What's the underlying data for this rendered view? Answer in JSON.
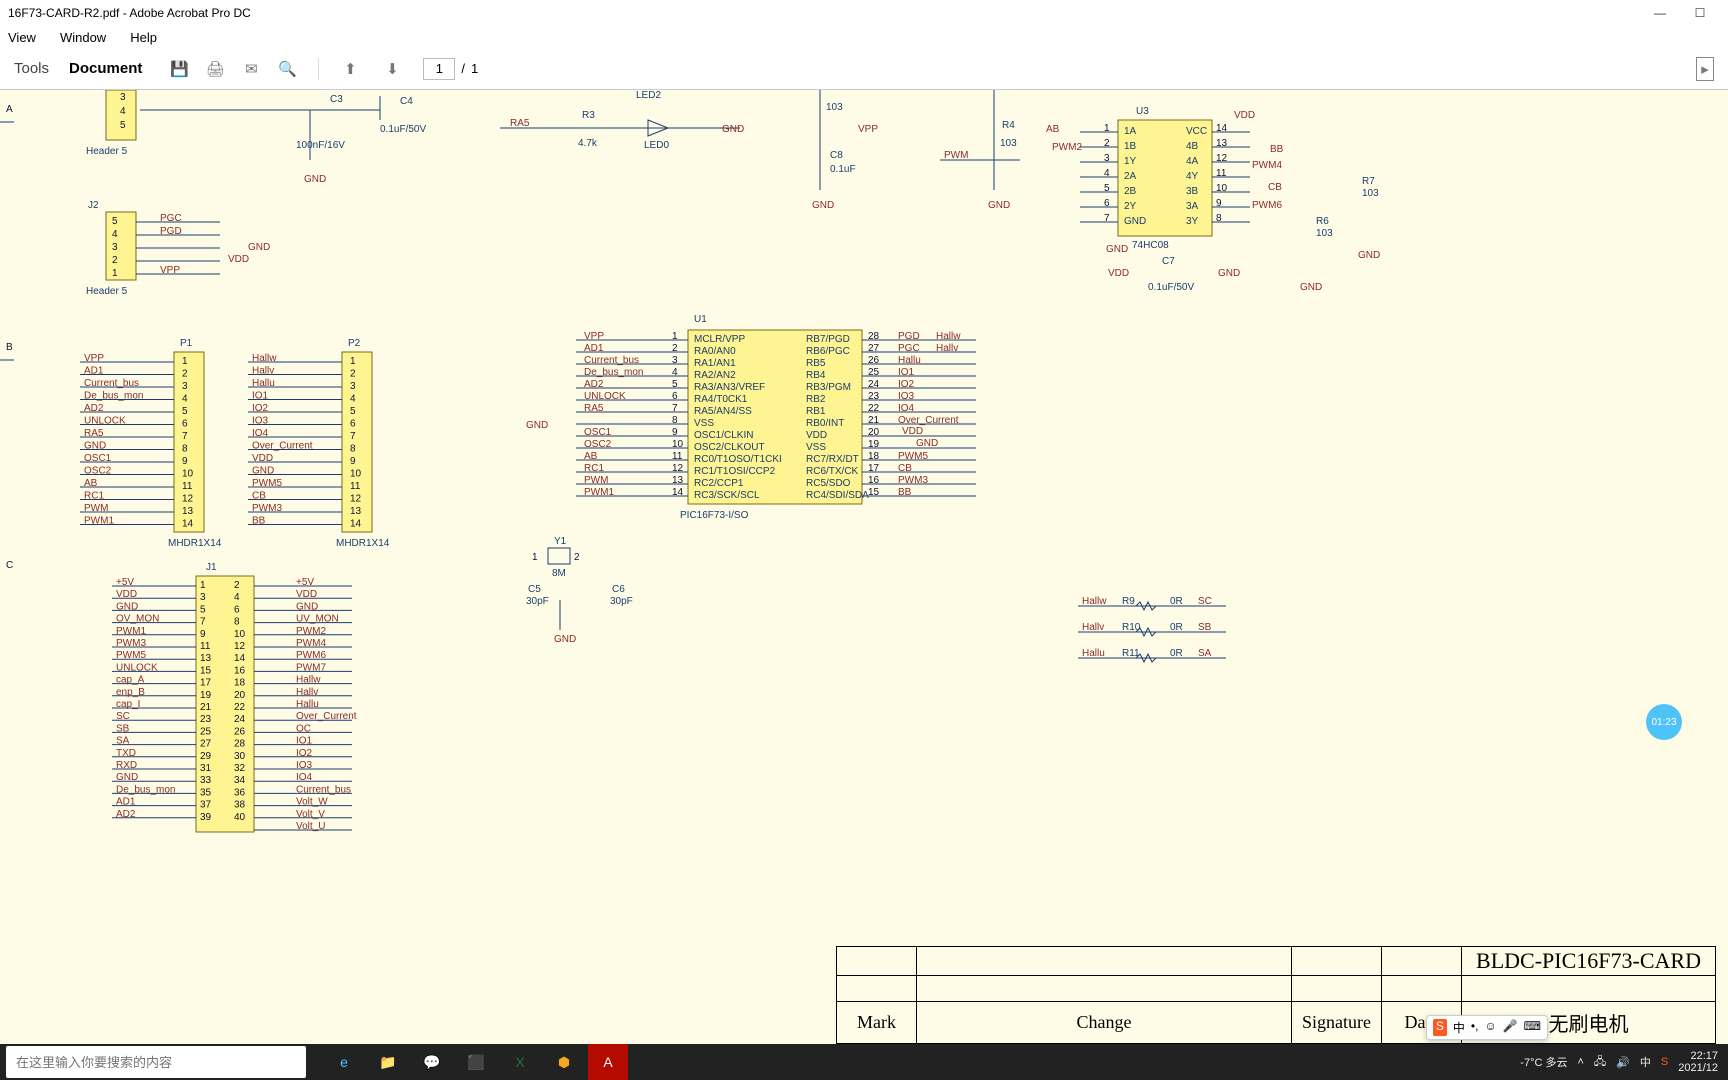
{
  "window": {
    "title": "16F73-CARD-R2.pdf - Adobe Acrobat Pro DC"
  },
  "menu": {
    "view": "View",
    "window": "Window",
    "help": "Help"
  },
  "toolbar": {
    "tools": "Tools",
    "document": "Document",
    "page_current": "1",
    "page_sep": "/",
    "page_total": "1"
  },
  "block": {
    "main_title": "BLDC-PIC16F73-CARD",
    "subtitle": "无刷电机",
    "mark": "Mark",
    "change": "Change",
    "signature": "Signature",
    "data": "Data"
  },
  "hall_res": [
    {
      "net": "Hallw",
      "ref": "R9",
      "val": "0R",
      "out": "SC"
    },
    {
      "net": "Hallv",
      "ref": "R10",
      "val": "0R",
      "out": "SB"
    },
    {
      "net": "Hallu",
      "ref": "R11",
      "val": "0R",
      "out": "SA"
    }
  ],
  "u1": {
    "ref": "U1",
    "part": "PIC16F73-I/SO",
    "left": [
      {
        "n": "1",
        "p": "MCLR/VPP",
        "net": "VPP"
      },
      {
        "n": "2",
        "p": "RA0/AN0",
        "net": "AD1"
      },
      {
        "n": "3",
        "p": "RA1/AN1",
        "net": "Current_bus"
      },
      {
        "n": "4",
        "p": "RA2/AN2",
        "net": "De_bus_mon"
      },
      {
        "n": "5",
        "p": "RA3/AN3/VREF",
        "net": "AD2"
      },
      {
        "n": "6",
        "p": "RA4/T0CK1",
        "net": "UNLOCK"
      },
      {
        "n": "7",
        "p": "RA5/AN4/SS",
        "net": "RA5"
      },
      {
        "n": "8",
        "p": "VSS",
        "net": ""
      },
      {
        "n": "9",
        "p": "OSC1/CLKIN",
        "net": "OSC1"
      },
      {
        "n": "10",
        "p": "OSC2/CLKOUT",
        "net": "OSC2"
      },
      {
        "n": "11",
        "p": "RC0/T1OSO/T1CKI",
        "net": "AB"
      },
      {
        "n": "12",
        "p": "RC1/T1OSI/CCP2",
        "net": "RC1"
      },
      {
        "n": "13",
        "p": "RC2/CCP1",
        "net": "PWM"
      },
      {
        "n": "14",
        "p": "RC3/SCK/SCL",
        "net": "PWM1"
      }
    ],
    "right": [
      {
        "n": "28",
        "p": "RB7/PGD",
        "net": "PGD",
        "net2": "Hallw"
      },
      {
        "n": "27",
        "p": "RB6/PGC",
        "net": "PGC",
        "net2": "Hallv"
      },
      {
        "n": "26",
        "p": "RB5",
        "net": "Hallu"
      },
      {
        "n": "25",
        "p": "RB4",
        "net": "IO1"
      },
      {
        "n": "24",
        "p": "RB3/PGM",
        "net": "IO2"
      },
      {
        "n": "23",
        "p": "RB2",
        "net": "IO3"
      },
      {
        "n": "22",
        "p": "RB1",
        "net": "IO4"
      },
      {
        "n": "21",
        "p": "RB0/INT",
        "net": "Over_Current"
      },
      {
        "n": "20",
        "p": "VDD",
        "net": ""
      },
      {
        "n": "19",
        "p": "VSS",
        "net": ""
      },
      {
        "n": "18",
        "p": "RC7/RX/DT",
        "net": "PWM5"
      },
      {
        "n": "17",
        "p": "RC6/TX/CK",
        "net": "CB"
      },
      {
        "n": "16",
        "p": "RC5/SDO",
        "net": "PWM3"
      },
      {
        "n": "15",
        "p": "RC4/SDI/SDA",
        "net": "BB"
      }
    ]
  },
  "u3": {
    "ref": "U3",
    "part": "74HC08",
    "pins": [
      {
        "n": "1",
        "p": "1A",
        "net": "AB"
      },
      {
        "n": "2",
        "p": "1B",
        "net": "PWM2"
      },
      {
        "n": "3",
        "p": "1Y",
        "net": ""
      },
      {
        "n": "4",
        "p": "2A",
        "net": ""
      },
      {
        "n": "5",
        "p": "2B",
        "net": ""
      },
      {
        "n": "6",
        "p": "2Y",
        "net": ""
      },
      {
        "n": "7",
        "p": "GND",
        "net": ""
      },
      {
        "n": "14",
        "p": "VCC",
        "net": "VDD"
      },
      {
        "n": "13",
        "p": "4B",
        "net": ""
      },
      {
        "n": "12",
        "p": "4A",
        "net": "BB"
      },
      {
        "n": "11",
        "p": "4Y",
        "net": "PWM4"
      },
      {
        "n": "10",
        "p": "3B",
        "net": ""
      },
      {
        "n": "9",
        "p": "3A",
        "net": "CB"
      },
      {
        "n": "8",
        "p": "3Y",
        "net": "PWM6"
      }
    ]
  },
  "p1": {
    "ref": "P1",
    "part": "MHDR1X14",
    "nets": [
      "VPP",
      "AD1",
      "Current_bus",
      "De_bus_mon",
      "AD2",
      "UNLOCK",
      "RA5",
      "GND",
      "OSC1",
      "OSC2",
      "AB",
      "RC1",
      "PWM",
      "PWM1"
    ]
  },
  "p2": {
    "ref": "P2",
    "part": "MHDR1X14",
    "nets": [
      "Hallw",
      "Hallv",
      "Hallu",
      "IO1",
      "IO2",
      "IO3",
      "IO4",
      "Over_Current",
      "VDD",
      "GND",
      "PWM5",
      "CB",
      "PWM3",
      "BB"
    ]
  },
  "j2": {
    "ref": "J2",
    "part": "Header 5",
    "nets": [
      "PGC",
      "PGD",
      "",
      "",
      "VPP"
    ]
  },
  "j1": {
    "ref": "J1",
    "left": [
      "+5V",
      "VDD",
      "GND",
      "OV_MON",
      "PWM1",
      "PWM3",
      "PWM5",
      "UNLOCK",
      "cap_A",
      "enp_B",
      "cap_I",
      "SC",
      "SB",
      "SA",
      "TXD",
      "RXD",
      "GND",
      "De_bus_mon",
      "AD1",
      "AD2"
    ],
    "right": [
      "+5V",
      "VDD",
      "GND",
      "UV_MON",
      "PWM2",
      "PWM4",
      "PWM6",
      "PWM7",
      "Hallw",
      "Hallv",
      "Hallu",
      "Over_Current",
      "OC",
      "IO1",
      "IO2",
      "IO3",
      "IO4",
      "Current_bus",
      "Volt_W",
      "Volt_V",
      "Volt_U"
    ],
    "lnums": [
      "1",
      "3",
      "5",
      "7",
      "9",
      "11",
      "13",
      "15",
      "17",
      "19",
      "21",
      "23",
      "25",
      "27",
      "29",
      "31",
      "33",
      "35",
      "37",
      "39"
    ],
    "rnums": [
      "2",
      "4",
      "6",
      "8",
      "10",
      "12",
      "14",
      "16",
      "18",
      "20",
      "22",
      "24",
      "26",
      "28",
      "30",
      "32",
      "34",
      "36",
      "38",
      "40"
    ]
  },
  "misc": {
    "header5": "Header 5",
    "c3": "C3",
    "c3v": "100nF/16V",
    "c4": "C4",
    "c4v": "0.1uF/50V",
    "r3": "R3",
    "r3v": "4.7k",
    "ra5": "RA5",
    "led2": "LED2",
    "led0": "LED0",
    "gnd": "GND",
    "r103": "103",
    "c8": "C8",
    "c8v": "0.1uF",
    "vpp": "VPP",
    "pwm": "PWM",
    "r4": "R4",
    "c7": "C7",
    "c7v": "0.1uF/50V",
    "vdd": "VDD",
    "r6": "R6",
    "r7": "R7",
    "y1": "Y1",
    "y1v": "8M",
    "c5": "C5",
    "c5v": "30pF",
    "c6": "C6",
    "c6v": "30pF",
    "pins": [
      "3",
      "4",
      "5"
    ]
  },
  "search": {
    "placeholder": "在这里输入你要搜索的内容"
  },
  "tray": {
    "weather": "-7°C 多云",
    "ime": "中",
    "time": "22:17",
    "date": "2021/12"
  },
  "badge": "01:23"
}
